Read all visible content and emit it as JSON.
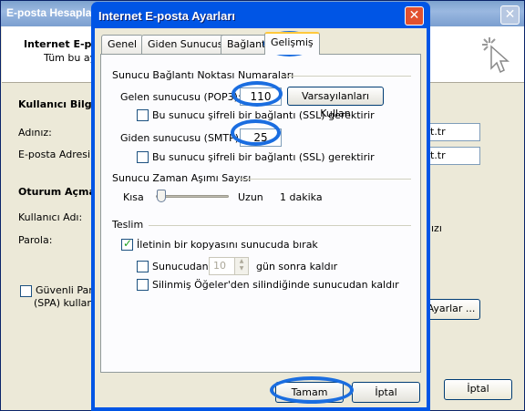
{
  "background": {
    "window_title": "E-posta Hesapla",
    "header_title": "Internet E-po",
    "header_sub": "Tüm bu aya",
    "user_info": "Kullanıcı Bilgile",
    "name_label": "Adınız:",
    "email_label": "E-posta Adresi:",
    "name_suffix": "t.tr",
    "email_suffix": "t.tr",
    "logon_info": "Oturum Açma",
    "username_label": "Kullanıcı Adı:",
    "password_label": "Parola:",
    "password_suffix": "ızı",
    "spa_line1": "Güvenli Parol",
    "spa_line2": "(SPA) kullana",
    "more_settings": "Ayarlar ...",
    "cancel": "İptal"
  },
  "dialog": {
    "title": "Internet E-posta Ayarları",
    "tabs": [
      "Genel",
      "Giden Sunucusu",
      "Bağlantı",
      "Gelişmiş"
    ],
    "server_ports_heading": "Sunucu Bağlantı Noktası Numaraları",
    "incoming_label": "Gelen sunucusu (POP3):",
    "incoming_port": "110",
    "defaults_button": "Varsayılanları Kullan",
    "incoming_ssl": "Bu sunucu şifreli bir bağlantı (SSL) gerektirir",
    "outgoing_label": "Giden sunucusu (SMTP):",
    "outgoing_port": "25",
    "outgoing_ssl": "Bu sunucu şifreli bir bağlantı (SSL) gerektirir",
    "timeout_heading": "Sunucu Zaman Aşımı Sayısı",
    "short": "Kısa",
    "long": "Uzun",
    "timeout_value": "1 dakika",
    "delivery_heading": "Teslim",
    "leave_copy": "İletinin bir kopyasını sunucuda bırak",
    "remove_from": "Sunucudan",
    "days_value": "10",
    "days_after": "gün sonra kaldır",
    "remove_deleted": "Silinmiş Öğeler'den silindiğinde sunucudan kaldır",
    "ok": "Tamam",
    "cancel": "İptal"
  }
}
